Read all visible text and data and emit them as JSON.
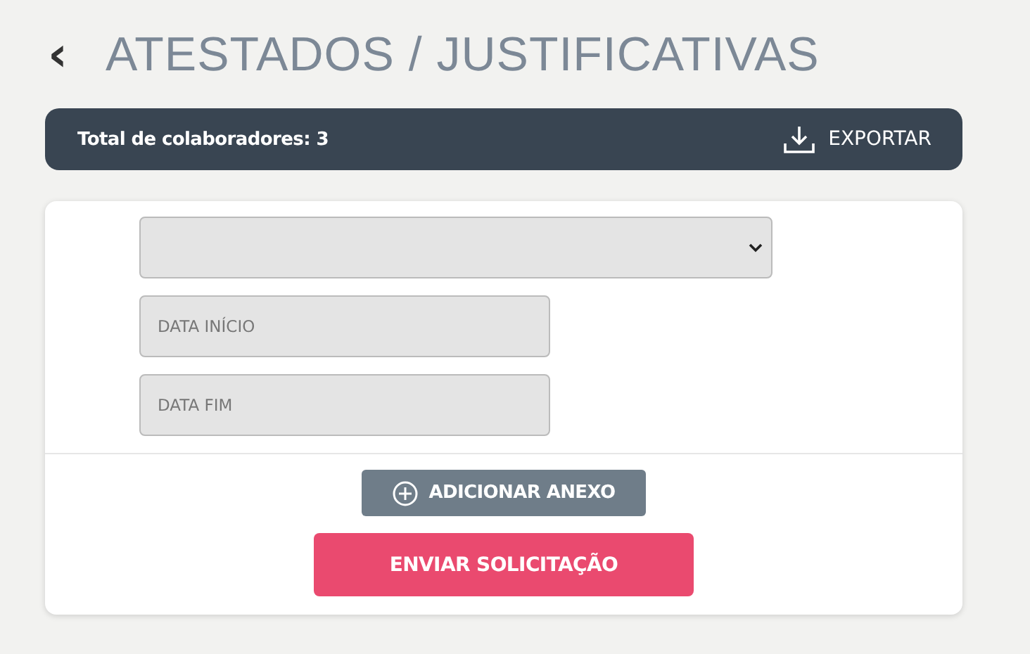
{
  "header": {
    "back_icon": "‹",
    "title": "ATESTADOS / JUSTIFICATIVAS"
  },
  "summary_bar": {
    "label": "Total de colaboradores: 3",
    "export_label": "EXPORTAR"
  },
  "form": {
    "fields": [
      {
        "kind": "select"
      },
      {
        "kind": "input",
        "placeholder": "DATA INÍCIO"
      },
      {
        "kind": "input",
        "placeholder": "DATA FIM"
      }
    ],
    "attach_button": "ADICIONAR ANEXO",
    "submit_button": "ENVIAR SOLICITAÇÃO"
  }
}
